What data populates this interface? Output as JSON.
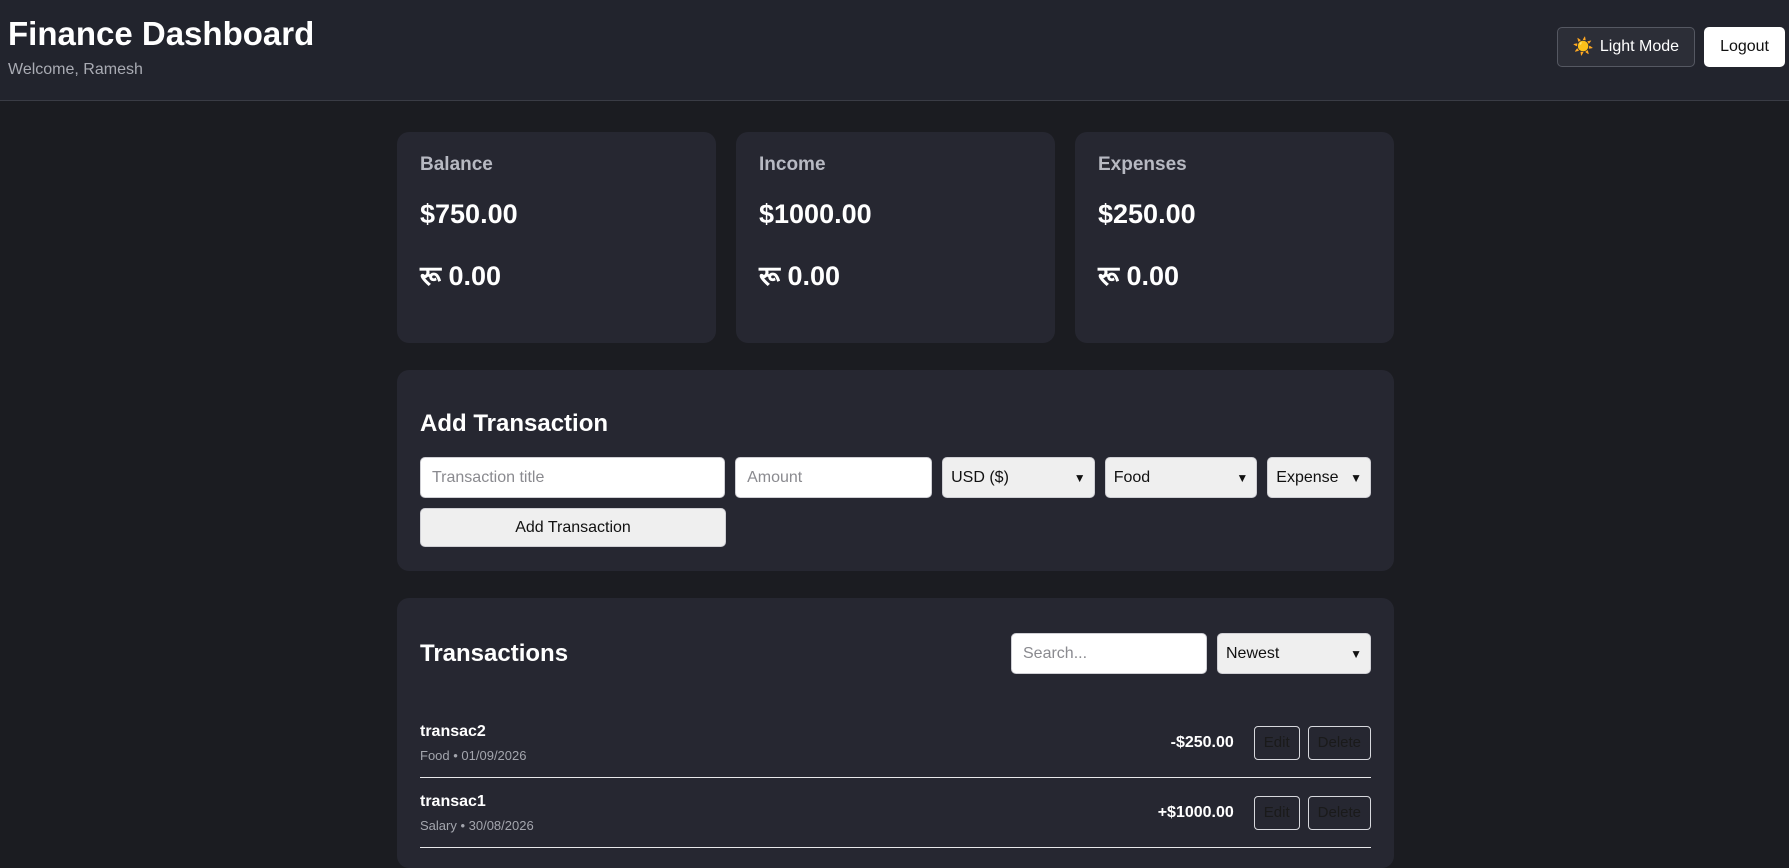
{
  "header": {
    "title": "Finance Dashboard",
    "welcome": "Welcome, Ramesh",
    "theme_label": "Light Mode",
    "theme_icon": "☀️",
    "logout_label": "Logout"
  },
  "summary": [
    {
      "label": "Balance",
      "usd": "$750.00",
      "npr": "रू 0.00"
    },
    {
      "label": "Income",
      "usd": "$1000.00",
      "npr": "रू 0.00"
    },
    {
      "label": "Expenses",
      "usd": "$250.00",
      "npr": "रू 0.00"
    }
  ],
  "add_form": {
    "title": "Add Transaction",
    "title_placeholder": "Transaction title",
    "amount_placeholder": "Amount",
    "currency_selected": "USD ($)",
    "category_selected": "Food",
    "type_selected": "Expense",
    "submit_label": "Add Transaction"
  },
  "transactions": {
    "title": "Transactions",
    "search_placeholder": "Search...",
    "sort_selected": "Newest",
    "edit_label": "Edit",
    "delete_label": "Delete",
    "items": [
      {
        "name": "transac2",
        "meta": "Food • 01/09/2026",
        "amount": "-$250.00"
      },
      {
        "name": "transac1",
        "meta": "Salary • 30/08/2026",
        "amount": "+$1000.00"
      }
    ]
  }
}
